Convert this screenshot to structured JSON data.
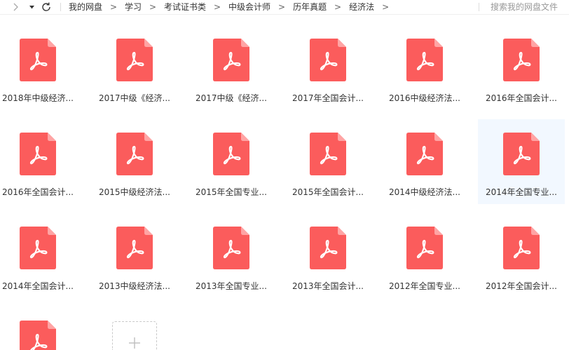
{
  "toolbar": {
    "forward_icon": "chevron-right-icon",
    "history_icon": "caret-down-icon",
    "refresh_icon": "refresh-icon"
  },
  "breadcrumb": {
    "items": [
      "我的网盘",
      "学习",
      "考试证书类",
      "中级会计师",
      "历年真题",
      "经济法"
    ],
    "separator": ">"
  },
  "search": {
    "placeholder": "搜索我的网盘文件"
  },
  "colors": {
    "pdf_icon": "#fb5c5c",
    "pdf_fold": "#ffa4a4",
    "hover_background": "#f2f8ff",
    "text": "#333333",
    "muted_text": "#999999"
  },
  "files": [
    {
      "name": "2018年中级经济...",
      "icon": "pdf-file-icon"
    },
    {
      "name": "2017中级《经济...",
      "icon": "pdf-file-icon"
    },
    {
      "name": "2017中级《经济...",
      "icon": "pdf-file-icon"
    },
    {
      "name": "2017年全国会计...",
      "icon": "pdf-file-icon"
    },
    {
      "name": "2016中级经济法...",
      "icon": "pdf-file-icon"
    },
    {
      "name": "2016年全国会计...",
      "icon": "pdf-file-icon"
    },
    {
      "name": "2016年全国会计...",
      "icon": "pdf-file-icon"
    },
    {
      "name": "2015中级经济法...",
      "icon": "pdf-file-icon"
    },
    {
      "name": "2015年全国专业...",
      "icon": "pdf-file-icon"
    },
    {
      "name": "2015年全国会计...",
      "icon": "pdf-file-icon"
    },
    {
      "name": "2014中级经济法...",
      "icon": "pdf-file-icon"
    },
    {
      "name": "2014年全国专业...",
      "icon": "pdf-file-icon",
      "highlighted": true
    },
    {
      "name": "2014年全国会计...",
      "icon": "pdf-file-icon"
    },
    {
      "name": "2013中级经济法...",
      "icon": "pdf-file-icon"
    },
    {
      "name": "2013年全国专业...",
      "icon": "pdf-file-icon"
    },
    {
      "name": "2013年全国会计...",
      "icon": "pdf-file-icon"
    },
    {
      "name": "2012年全国专业...",
      "icon": "pdf-file-icon"
    },
    {
      "name": "2012年全国会计...",
      "icon": "pdf-file-icon"
    },
    {
      "icon": "pdf-file-icon"
    }
  ],
  "add_tile": {
    "icon": "plus-icon"
  }
}
